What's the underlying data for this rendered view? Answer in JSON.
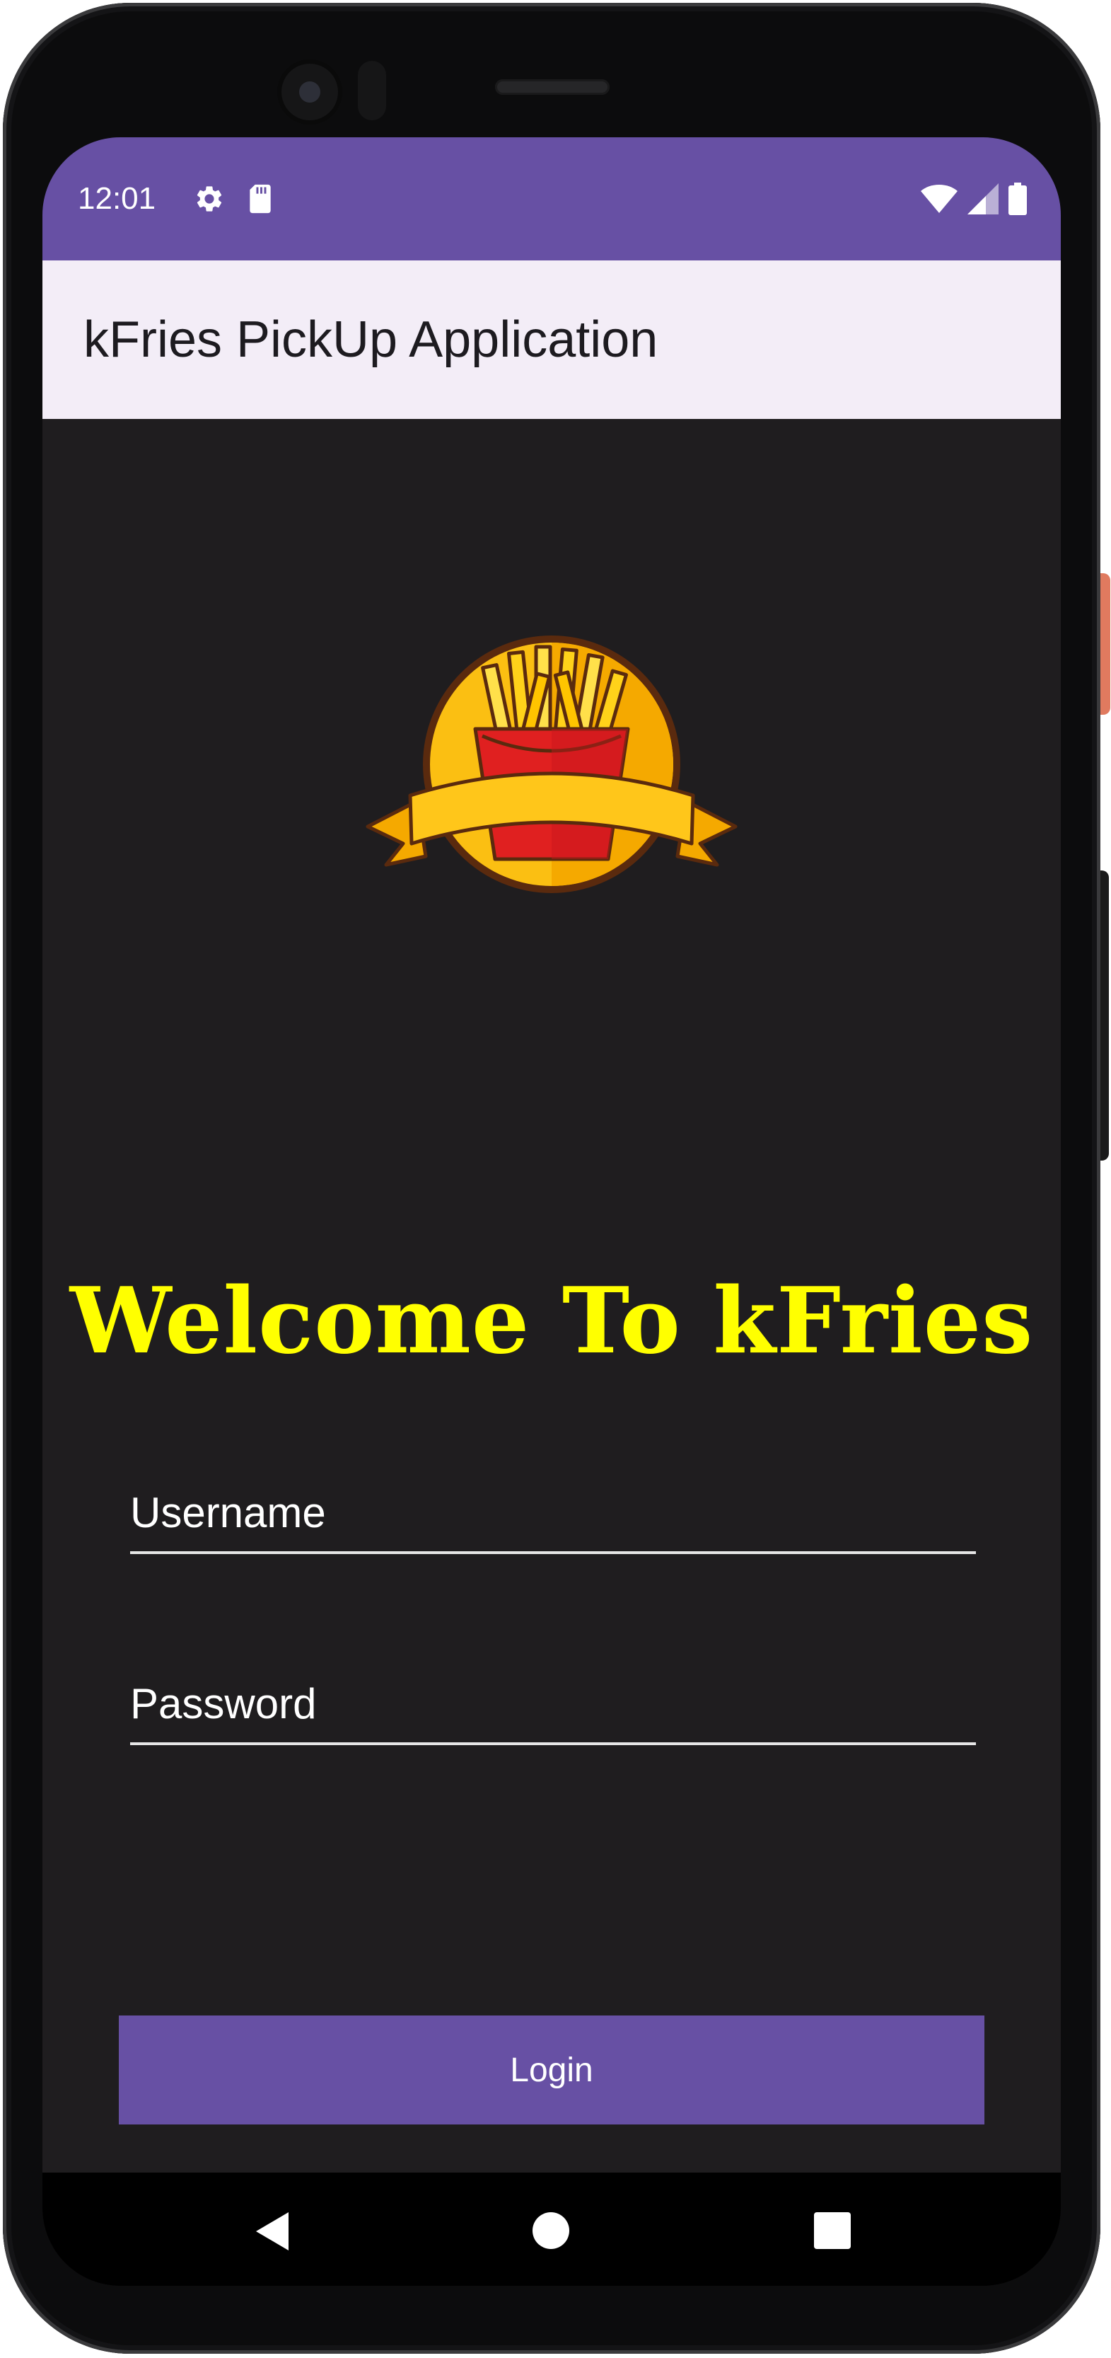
{
  "status_bar": {
    "time": "12:01",
    "left_icons": [
      "gear-icon",
      "sd-card-icon"
    ],
    "right_icons": [
      "wifi-icon",
      "signal-icon",
      "battery-icon"
    ],
    "background": "#6750a4"
  },
  "app_bar": {
    "title": "kFries PickUp Application",
    "background": "#f3edf7"
  },
  "main": {
    "logo_icon": "fries-logo-icon",
    "welcome_text": "Welcome To kFries",
    "welcome_color": "#ffff00",
    "username": {
      "placeholder": "Username",
      "value": ""
    },
    "password": {
      "placeholder": "Password",
      "value": ""
    },
    "login_label": "Login",
    "accent": "#6750a4"
  },
  "nav_bar": {
    "icons": [
      "back-triangle-icon",
      "home-circle-icon",
      "recents-square-icon"
    ]
  }
}
